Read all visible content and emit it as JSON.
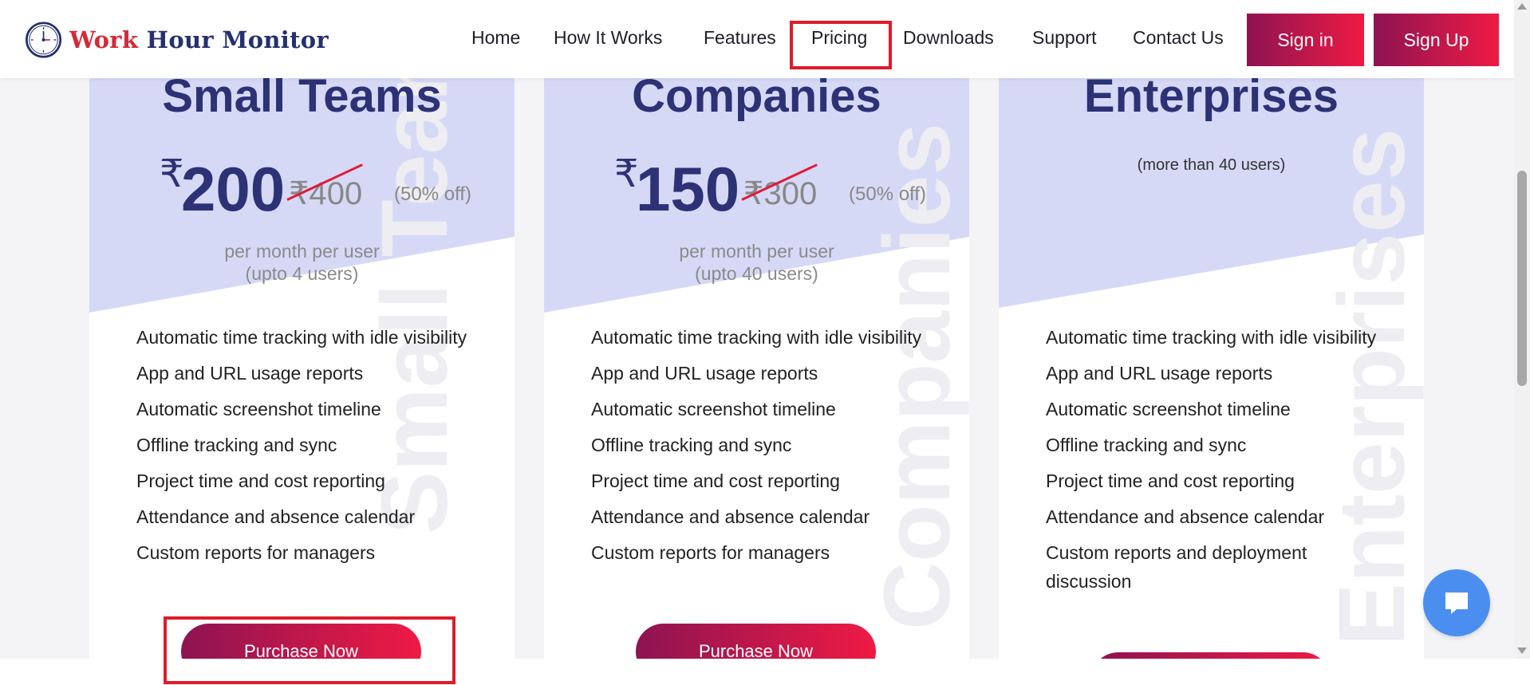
{
  "header": {
    "logo": {
      "word1": "Work",
      "word2": "Hour Monitor",
      "icon": "clock-icon"
    },
    "nav": [
      {
        "label": "Home"
      },
      {
        "label": "How It Works"
      },
      {
        "label": "Features"
      },
      {
        "label": "Pricing"
      },
      {
        "label": "Downloads"
      },
      {
        "label": "Support"
      },
      {
        "label": "Contact Us"
      }
    ],
    "sign_in": "Sign in",
    "sign_up": "Sign Up"
  },
  "plans": [
    {
      "title": "Small Teams",
      "watermark": "Small Teams",
      "currency": "₹",
      "price": "200",
      "old_price": "₹400",
      "discount": "(50% off)",
      "per_month": "per month per user",
      "user_limit": "(upto 4 users)",
      "features": [
        "Automatic time tracking with idle visibility",
        "App and URL usage reports",
        "Automatic screenshot timeline",
        "Offline tracking and sync",
        "Project time and cost reporting",
        "Attendance and absence calendar",
        "Custom reports for managers"
      ],
      "button": "Purchase Now"
    },
    {
      "title": "Companies",
      "watermark": "Companies",
      "currency": "₹",
      "price": "150",
      "old_price": "₹300",
      "discount": "(50% off)",
      "per_month": "per month per user",
      "user_limit": "(upto 40 users)",
      "features": [
        "Automatic time tracking with idle visibility",
        "App and URL usage reports",
        "Automatic screenshot timeline",
        "Offline tracking and sync",
        "Project time and cost reporting",
        "Attendance and absence calendar",
        "Custom reports for managers"
      ],
      "button": "Purchase Now"
    },
    {
      "title": "Enterprises",
      "watermark": "Enterprises",
      "note": "(more than 40 users)",
      "features": [
        "Automatic time tracking with idle visibility",
        "App and URL usage reports",
        "Automatic screenshot timeline",
        "Offline tracking and sync",
        "Project time and cost reporting",
        "Attendance and absence calendar",
        "Custom reports and deployment discussion"
      ]
    }
  ],
  "colors": {
    "brand_dark": "#2c3275",
    "brand_red": "#d52a39",
    "gradient_start": "#8d1452",
    "gradient_end": "#ef1a44",
    "card_tint": "#d6d9f6",
    "highlight_box": "#e01b2a",
    "chat_bubble": "#4a8ff0"
  },
  "chat_icon": "chat-bubble-icon"
}
